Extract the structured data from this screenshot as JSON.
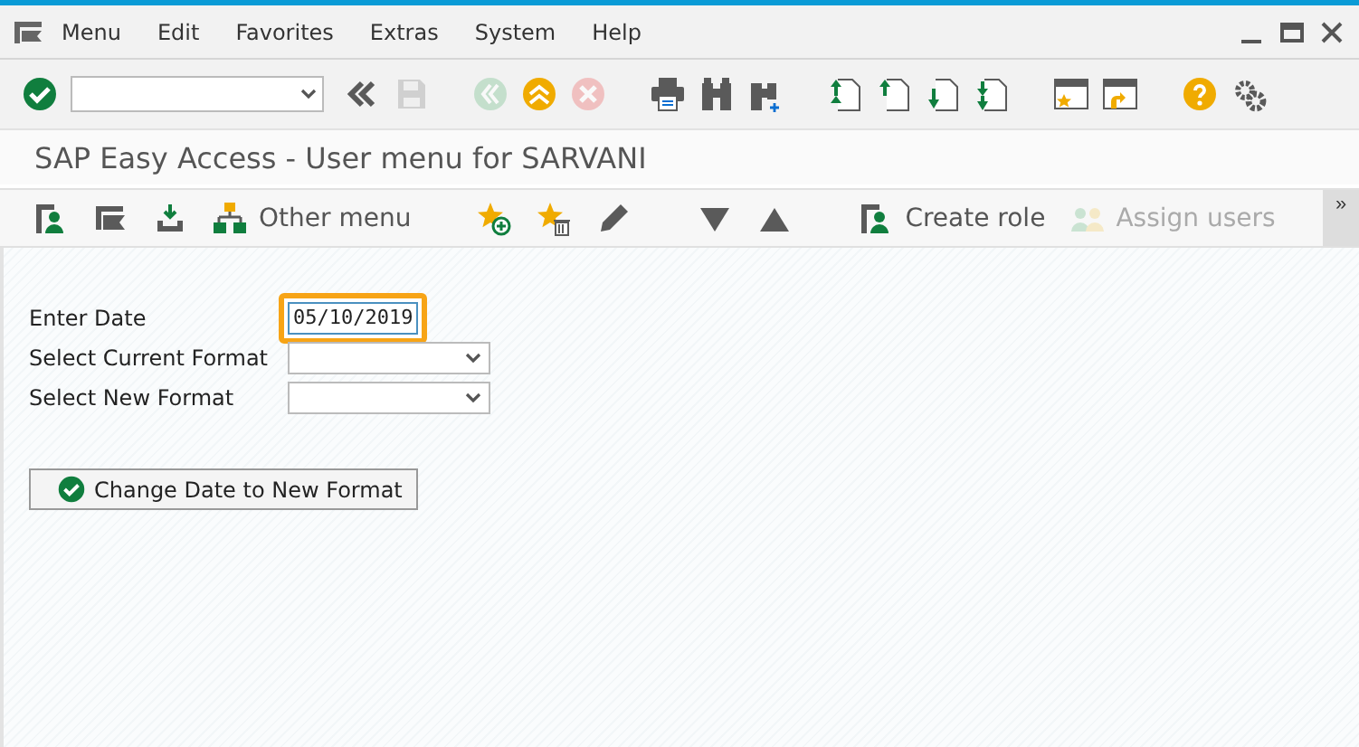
{
  "menu_bar": {
    "items": [
      "Menu",
      "Edit",
      "Favorites",
      "Extras",
      "System",
      "Help"
    ]
  },
  "toolbar": {
    "buttons": [
      {
        "kind": "enter",
        "disabled": false
      },
      {
        "kind": "command-field"
      },
      {
        "kind": "collapse",
        "disabled": false
      },
      {
        "kind": "save",
        "disabled": true
      },
      {
        "kind": "back",
        "disabled": true
      },
      {
        "kind": "exit",
        "disabled": false
      },
      {
        "kind": "cancel",
        "disabled": true
      },
      {
        "kind": "print",
        "disabled": false
      },
      {
        "kind": "find",
        "disabled": false
      },
      {
        "kind": "find-next",
        "disabled": false
      },
      {
        "kind": "first-page",
        "disabled": false
      },
      {
        "kind": "prev-page",
        "disabled": false
      },
      {
        "kind": "next-page",
        "disabled": false
      },
      {
        "kind": "last-page",
        "disabled": false
      },
      {
        "kind": "new-session",
        "disabled": false
      },
      {
        "kind": "shortcut",
        "disabled": false
      },
      {
        "kind": "help",
        "disabled": false
      },
      {
        "kind": "settings",
        "disabled": false
      }
    ]
  },
  "title": "SAP Easy Access  -  User menu for SARVANI",
  "app_toolbar": {
    "items": [
      {
        "kind": "user-menu",
        "disabled": false
      },
      {
        "kind": "sap-menu",
        "disabled": false
      },
      {
        "kind": "import",
        "disabled": false
      },
      {
        "kind": "other-menu",
        "label": "Other menu",
        "disabled": false
      },
      {
        "kind": "add-favorite",
        "disabled": false
      },
      {
        "kind": "delete-favorite",
        "disabled": false
      },
      {
        "kind": "edit",
        "disabled": false
      },
      {
        "kind": "down",
        "disabled": false
      },
      {
        "kind": "up",
        "disabled": false
      },
      {
        "kind": "create-role",
        "label": "Create role",
        "disabled": false
      },
      {
        "kind": "assign-users",
        "label": "Assign users",
        "disabled": true
      }
    ],
    "overflow": "»"
  },
  "form": {
    "fields": [
      {
        "kind": "text",
        "label": "Enter Date",
        "value": "05/10/2019",
        "highlighted": true
      },
      {
        "kind": "dropdown",
        "label": "Select Current Format",
        "highlighted": false
      },
      {
        "kind": "dropdown",
        "label": "Select New Format",
        "highlighted": false
      }
    ],
    "button": {
      "label": "Change Date to New Format"
    }
  }
}
